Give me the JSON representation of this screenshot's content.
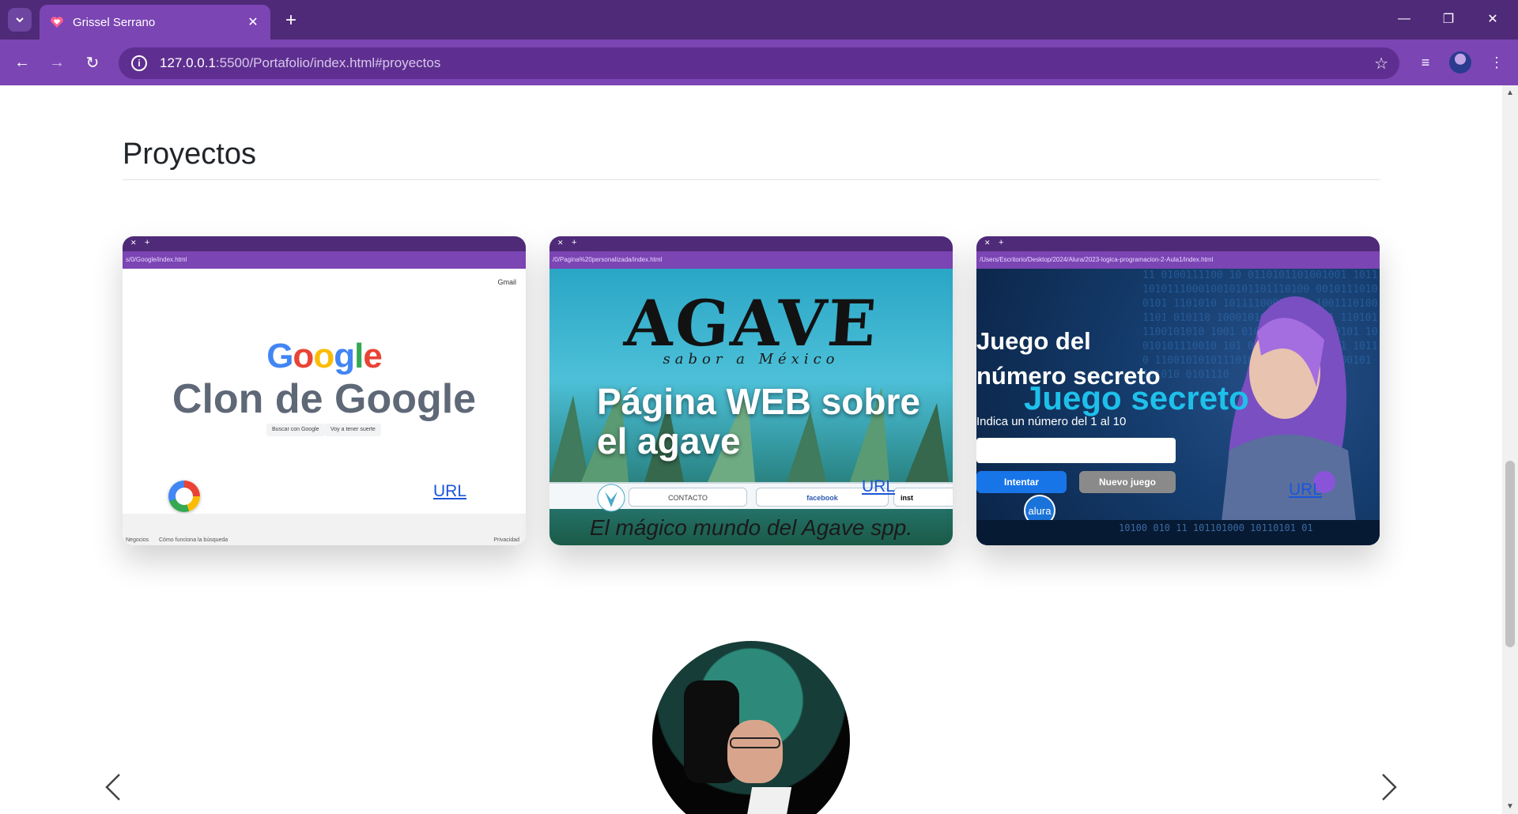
{
  "browser": {
    "tab_title": "Grissel Serrano",
    "url_host": "127.0.0.1",
    "url_path": ":5500/Portafolio/index.html#proyectos",
    "colors": {
      "tabbar": "#4f2a78",
      "toolbar": "#7b45b4"
    }
  },
  "section": {
    "title": "Proyectos"
  },
  "projects": [
    {
      "title": "Clon de Google",
      "link_label": "URL",
      "mini_url": "s/0/Google/index.html",
      "logo_text": "Google",
      "top_link": "Gmail",
      "buttons": [
        "Buscar con Google",
        "Voy a tener suerte"
      ],
      "footer": [
        "Negocios",
        "Cómo funciona la búsqueda",
        "Privacidad"
      ]
    },
    {
      "title": "Página WEB sobre el agave",
      "link_label": "URL",
      "mini_url": "/0/Pagina%20personalizada/index.html",
      "logo_text": "AGAVE",
      "logo_sub": "sabor a México",
      "nav": [
        "CONTACTO",
        "facebook",
        "inst"
      ],
      "bottom_text": "El mágico mundo del Agave spp."
    },
    {
      "title": "Juego secreto",
      "link_label": "URL",
      "mini_url": "/Users/Escritorio/Desktop/2024/Alura/2023-logica-programacion-2-Aula1/index.html",
      "heading_line1": "Juego del",
      "heading_line2": "número secreto",
      "hint": "Indica un número del 1 al 10",
      "btn_try": "Intentar",
      "btn_new": "Nuevo juego",
      "alura": "alura",
      "binary_bottom": "10100 010 11 101101000 10110101 01"
    }
  ]
}
